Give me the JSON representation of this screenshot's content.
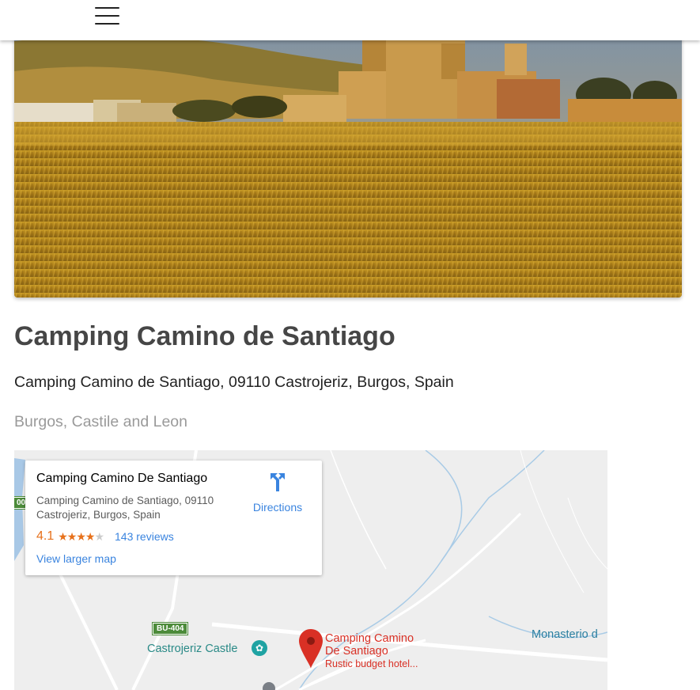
{
  "header": {
    "menu_icon": "hamburger-menu-icon"
  },
  "hero": {
    "image_description_icon": "hero-photo"
  },
  "place": {
    "title": "Camping Camino de Santiago",
    "address": "Camping Camino de Santiago, 09110 Castrojeriz, Burgos, Spain",
    "region": "Burgos, Castile and Leon"
  },
  "map": {
    "card": {
      "name": "Camping Camino De Santiago",
      "address": "Camping Camino de Santiago, 09110 Castrojeriz, Burgos, Spain",
      "rating": "4.1",
      "stars_filled": 4,
      "stars_total": 5,
      "reviews": "143 reviews",
      "directions": "Directions",
      "larger_map": "View larger map"
    },
    "labels": {
      "road": "BU-404",
      "castle": "Castrojeriz Castle",
      "monastery": "Monasterio d",
      "pin_name_line1": "Camping Camino",
      "pin_name_line2": "De Santiago",
      "pin_sub": "Rustic budget hotel..."
    },
    "colors": {
      "accent_orange": "#e7711b",
      "link_blue": "#3a84df",
      "pin_red": "#d93025",
      "road_green": "#4c8b3a"
    }
  }
}
